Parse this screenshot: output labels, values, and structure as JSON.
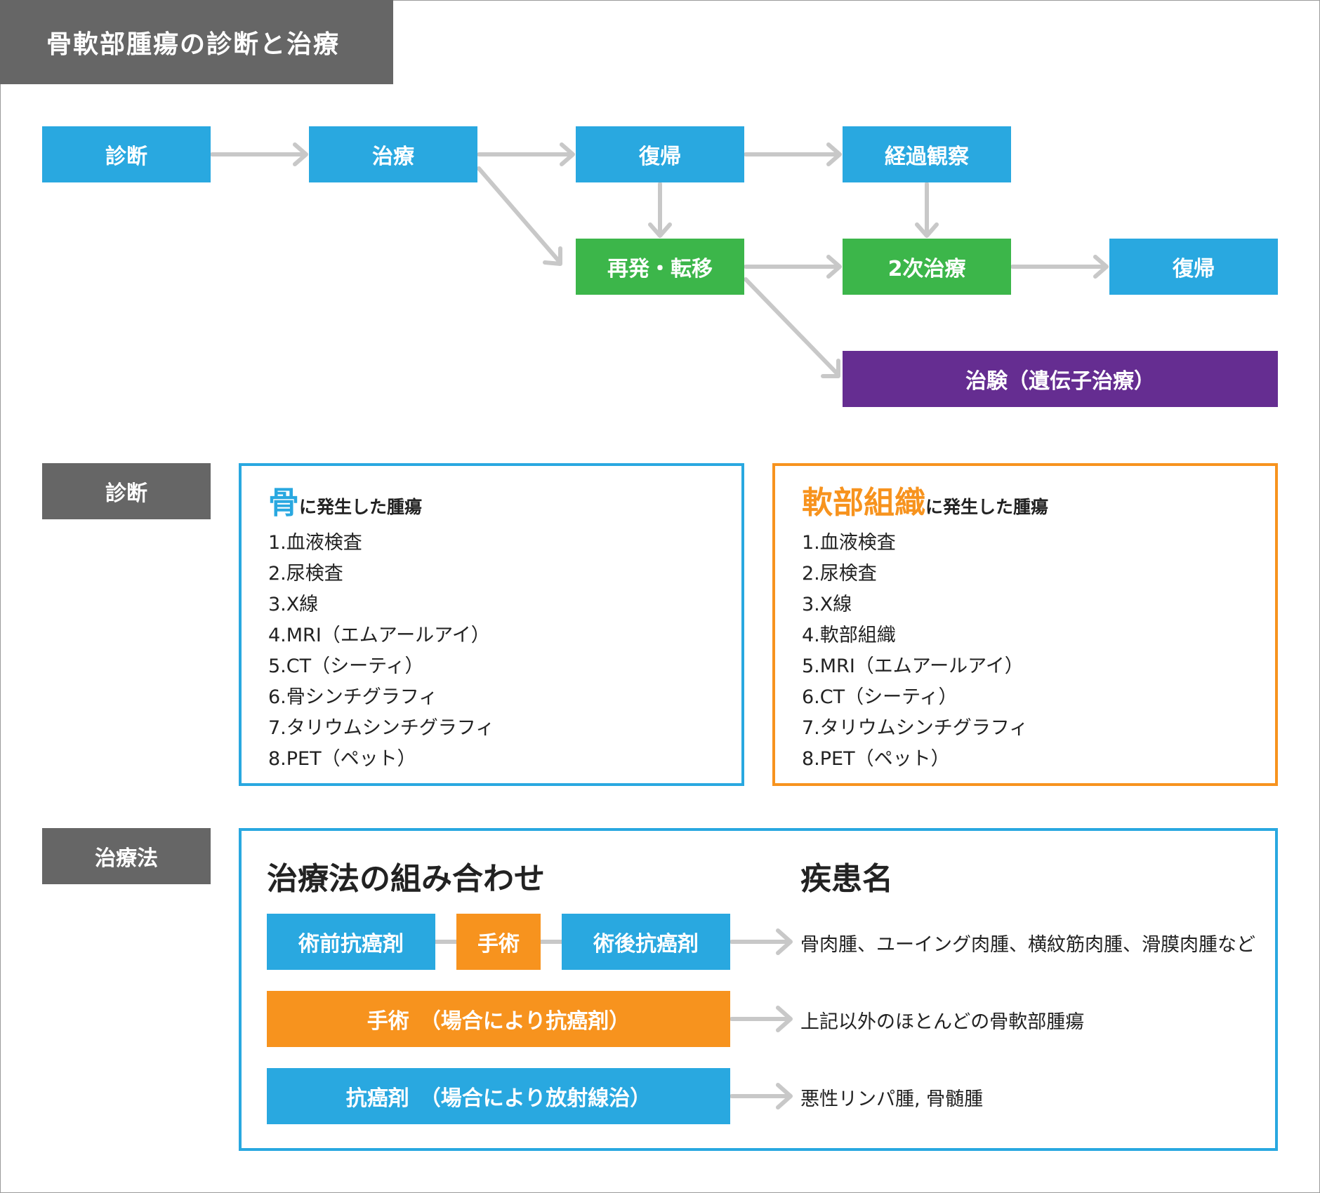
{
  "title": "骨軟部腫瘍の診断と治療",
  "flow": {
    "diagnosis": "診断",
    "treatment": "治療",
    "return1": "復帰",
    "follow_up": "経過観察",
    "recurrence": "再発・転移",
    "secondary_treatment": "2次治療",
    "return2": "復帰",
    "clinical_trial": "治験（遺伝子治療）"
  },
  "diagnosis_section": {
    "label": "診断",
    "bone": {
      "highlight": "骨",
      "suffix": "に発生した腫瘍",
      "items": [
        "1.血液検査",
        "2.尿検査",
        "3.X線",
        "4.MRI（エムアールアイ）",
        "5.CT（シーティ）",
        "6.骨シンチグラフィ",
        "7.タリウムシンチグラフィ",
        "8.PET（ペット）"
      ]
    },
    "soft_tissue": {
      "highlight": "軟部組織",
      "suffix": "に発生した腫瘍",
      "items": [
        "1.血液検査",
        "2.尿検査",
        "3.X線",
        "4.軟部組織",
        "5.MRI（エムアールアイ）",
        "6.CT（シーティ）",
        "7.タリウムシンチグラフィ",
        "8.PET（ペット）"
      ]
    }
  },
  "treatment_section": {
    "label": "治療法",
    "combo_heading": "治療法の組み合わせ",
    "disease_heading": "疾患名",
    "row1": {
      "pre": "術前抗癌剤",
      "surgery": "手術",
      "post": "術後抗癌剤",
      "diseases": "骨肉腫、ユーイング肉腫、横紋筋肉腫、滑膜肉腫など"
    },
    "row2": {
      "label": "手術　（場合により抗癌剤）",
      "diseases": "上記以外のほとんどの骨軟部腫瘍"
    },
    "row3": {
      "label": "抗癌剤　（場合により放射線治）",
      "diseases": "悪性リンパ腫, 骨髄腫"
    }
  },
  "colors": {
    "blue": "#29a8e0",
    "green": "#3cb64a",
    "purple": "#652d91",
    "orange": "#f7931e",
    "gray": "#666666",
    "arrow": "#c8c8c8"
  }
}
